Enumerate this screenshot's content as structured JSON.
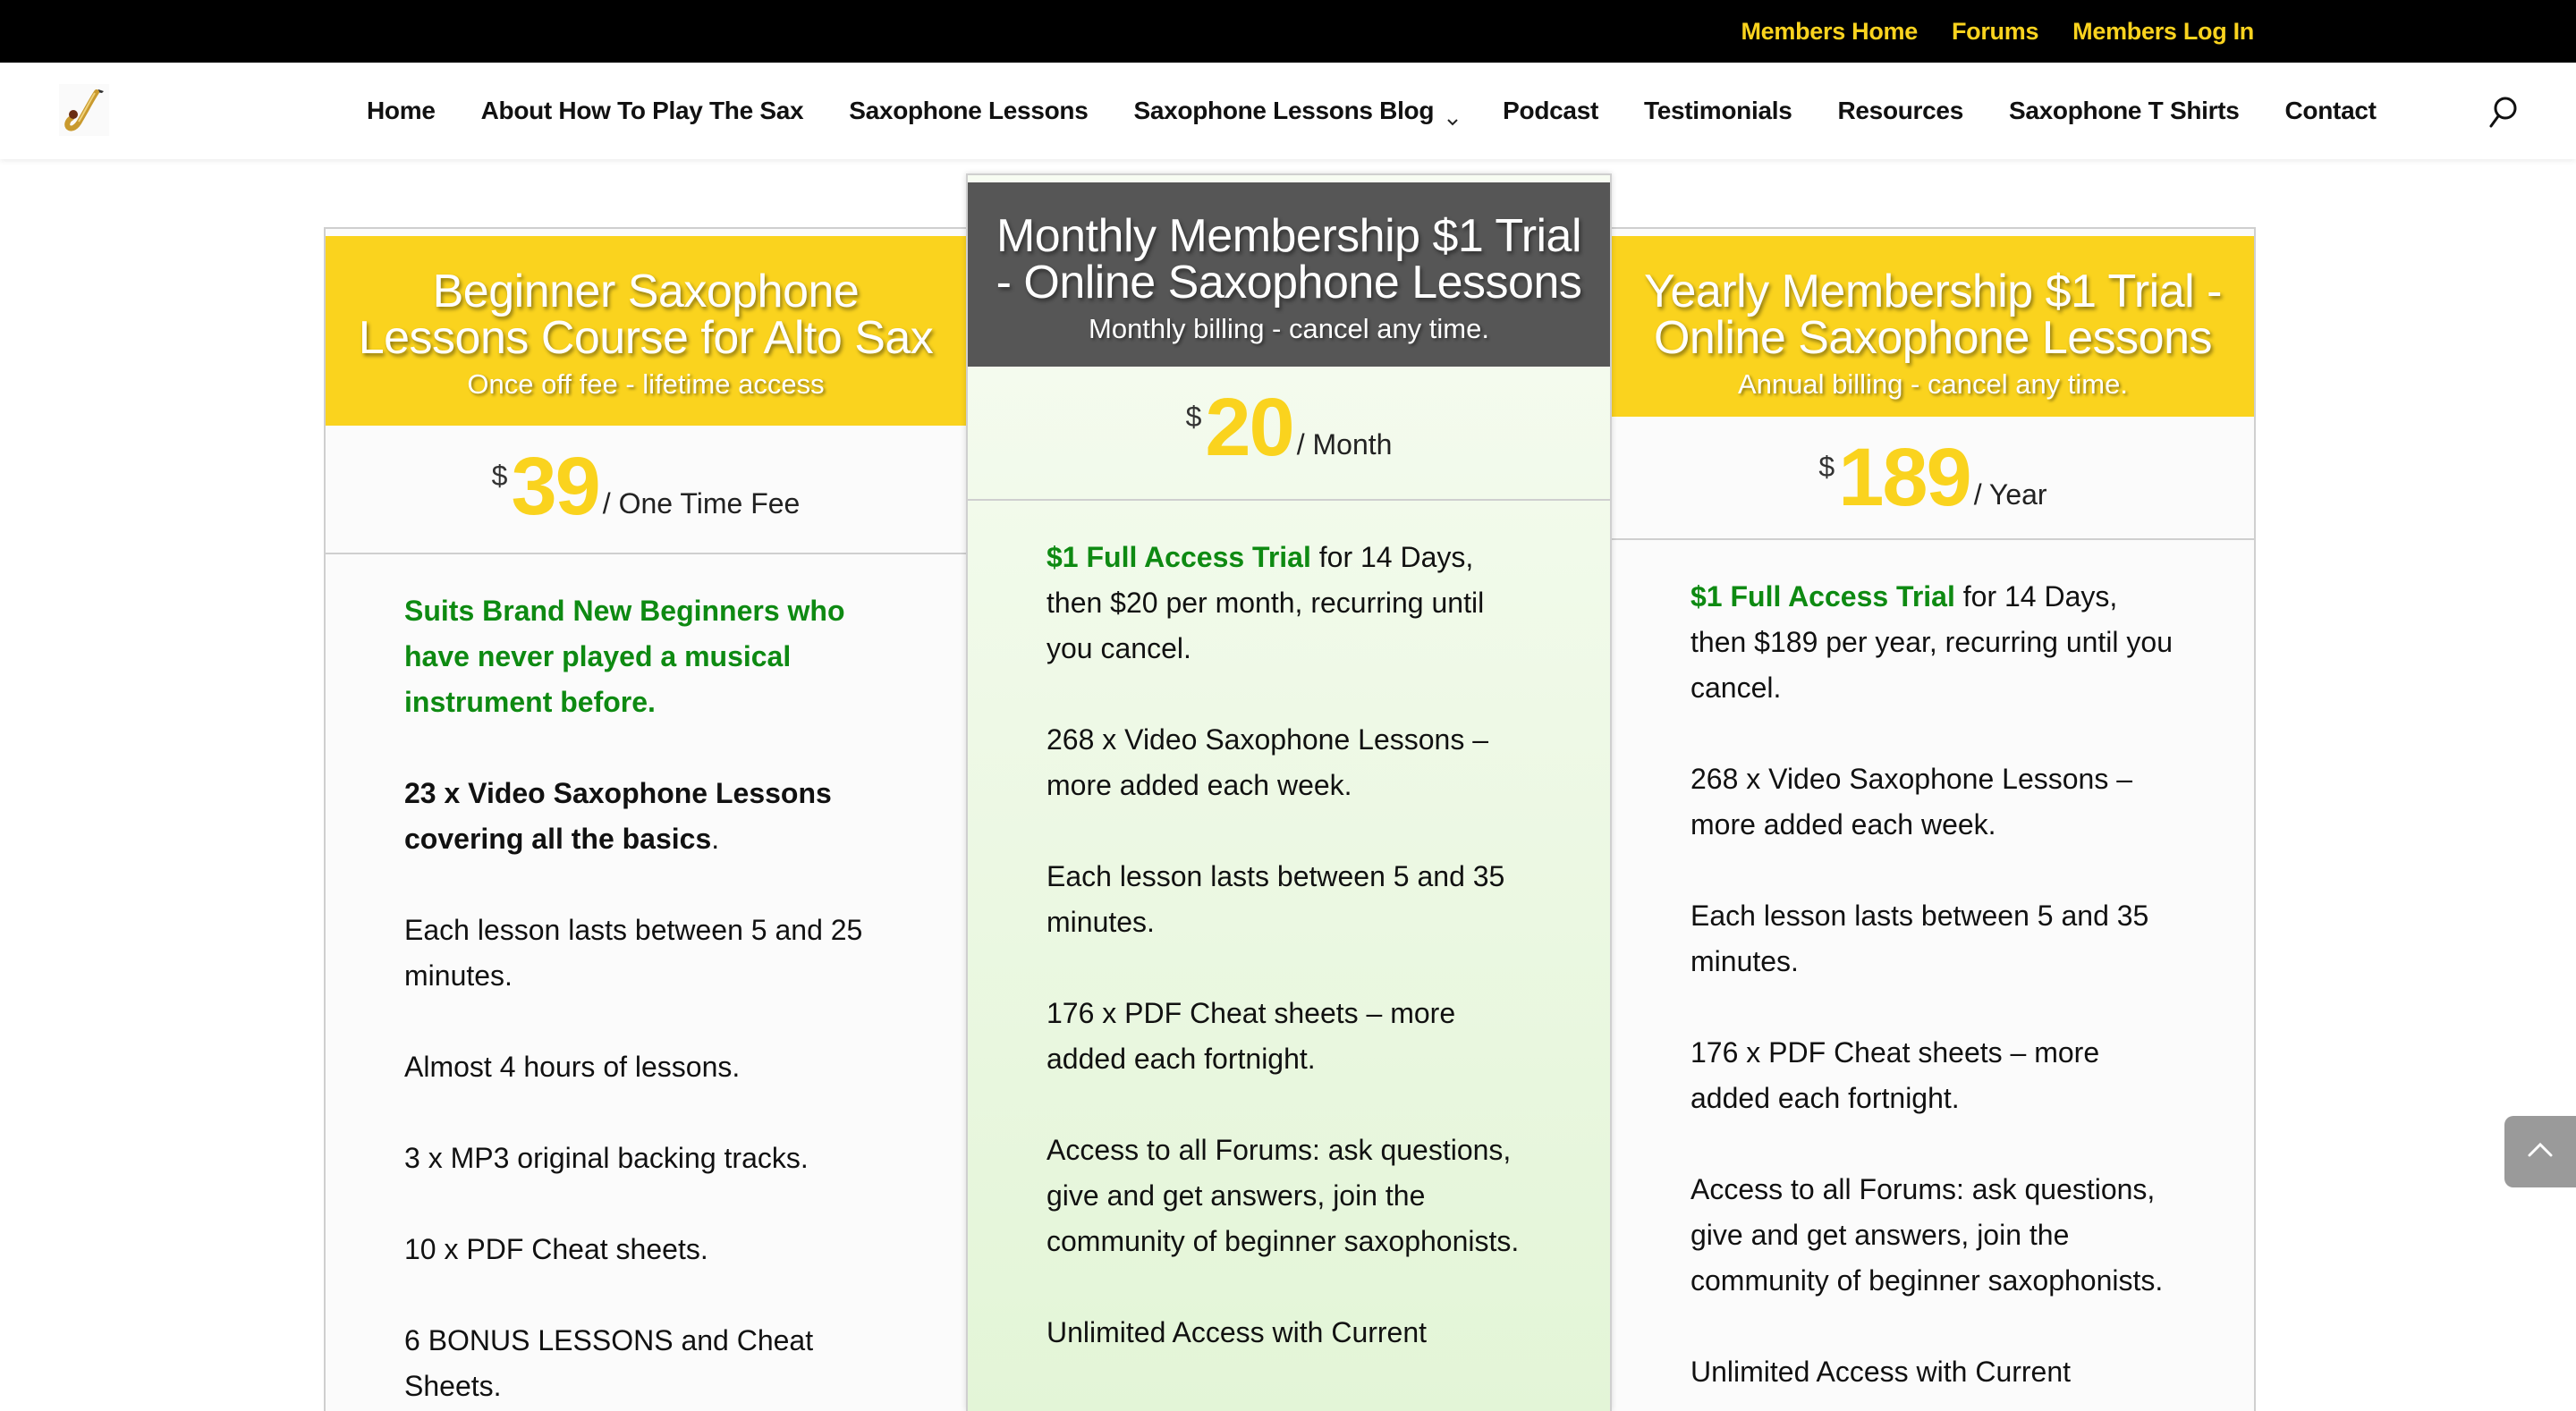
{
  "topbar": {
    "links": [
      "Members Home",
      "Forums",
      "Members Log In"
    ]
  },
  "colors": {
    "accent_yellow": "#FAD31E",
    "featured_header": "#565656",
    "highlight_green": "#0e8a12"
  },
  "nav": {
    "logo": "saxophone-logo",
    "items": [
      {
        "label": "Home"
      },
      {
        "label": "About How To Play The Sax"
      },
      {
        "label": "Saxophone Lessons"
      },
      {
        "label": "Saxophone Lessons Blog",
        "has_dropdown": true
      },
      {
        "label": "Podcast"
      },
      {
        "label": "Testimonials"
      },
      {
        "label": "Resources"
      },
      {
        "label": "Saxophone T Shirts"
      },
      {
        "label": "Contact"
      }
    ],
    "search_icon": "search-icon"
  },
  "plans": [
    {
      "title_line1": "Beginner Saxophone",
      "title_line2": "Lessons Course for Alto Sax",
      "subtitle": "Once off fee - lifetime access",
      "currency": "$",
      "amount": "39",
      "period": "/ One Time Fee",
      "features": [
        {
          "green": "Suits Brand New Beginners who have never played a musical instrument before."
        },
        {
          "bold": "23 x Video Saxophone Lessons covering all the basics",
          "text": "."
        },
        {
          "text": "Each lesson lasts between 5 and 25 minutes."
        },
        {
          "text": "Almost 4 hours of lessons."
        },
        {
          "text": "3 x MP3 original backing tracks."
        },
        {
          "text": "10 x PDF Cheat sheets."
        },
        {
          "bold": "6 BONUS LESSONS and Cheat Sheets."
        }
      ]
    },
    {
      "title_line1": "Monthly Membership $1 Trial",
      "title_line2": "- Online Saxophone Lessons",
      "subtitle": "Monthly billing - cancel any time.",
      "currency": "$",
      "amount": "20",
      "period": "/ Month",
      "features": [
        {
          "highlight": "$1 Full Access Trial",
          "text": " for 14 Days, then $20 per month, recurring until you cancel."
        },
        {
          "text": "268 x Video Saxophone Lessons – more added each week."
        },
        {
          "text": "Each lesson lasts between 5 and 35 minutes."
        },
        {
          "text": "176 x PDF Cheat sheets – more added each fortnight."
        },
        {
          "text": "Access to all Forums: ask questions, give and get answers, join the community of beginner saxophonists."
        },
        {
          "text": "Unlimited Access with Current"
        }
      ]
    },
    {
      "title_line1": "Yearly Membership $1 Trial -",
      "title_line2": "Online Saxophone Lessons",
      "subtitle": "Annual billing - cancel any time.",
      "currency": "$",
      "amount": "189",
      "period": "/ Year",
      "features": [
        {
          "highlight": "$1 Full Access Trial",
          "text": " for 14 Days, then $189 per year, recurring until you cancel."
        },
        {
          "text": "268 x Video Saxophone Lessons – more added each week."
        },
        {
          "text": "Each lesson lasts between 5 and 35 minutes."
        },
        {
          "text": "176 x PDF Cheat sheets – more added each fortnight."
        },
        {
          "text": "Access to all Forums: ask questions, give and get answers, join the community of beginner saxophonists."
        },
        {
          "text": "Unlimited Access with Current"
        }
      ]
    }
  ],
  "back_to_top": "back-to-top-icon"
}
